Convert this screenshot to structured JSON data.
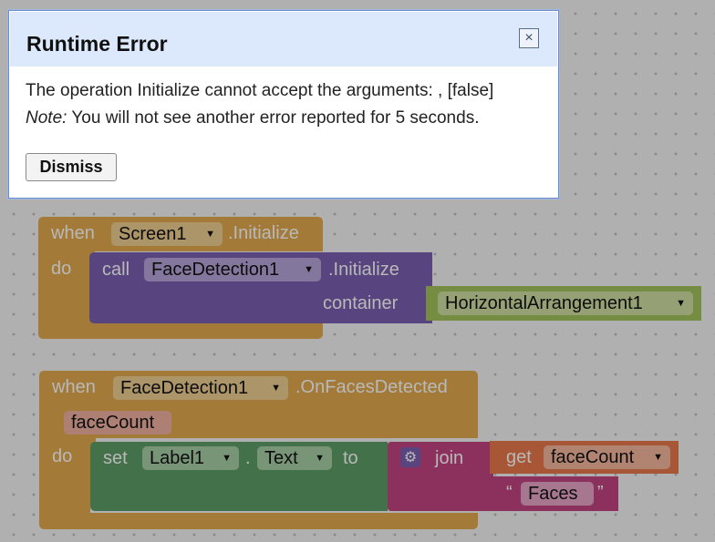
{
  "dialog": {
    "title": "Runtime Error",
    "close_glyph": "×",
    "message": "The operation Initialize cannot accept the arguments: , [false]",
    "note_label": "Note:",
    "note_text": "You will not see another error reported for 5 seconds.",
    "dismiss_label": "Dismiss"
  },
  "event1": {
    "when": "when",
    "component": "Screen1",
    "event": ".Initialize",
    "do": "do",
    "call": "call",
    "call_component": "FaceDetection1",
    "call_method": ".Initialize",
    "param": "container",
    "param_value": "HorizontalArrangement1"
  },
  "event2": {
    "when": "when",
    "component": "FaceDetection1",
    "event": ".OnFacesDetected",
    "param": "faceCount",
    "do": "do",
    "set": "set",
    "set_component": "Label1",
    "dot": ".",
    "property": "Text",
    "to": "to",
    "join": "join",
    "get": "get",
    "get_var": "faceCount",
    "quote_open": "“",
    "string_value": "Faces",
    "quote_close": "”"
  },
  "colors": {
    "event": "#e3a94f",
    "call": "#7a5fb0",
    "component": "#a2c35d",
    "set": "#5e9e67",
    "join": "#c24382",
    "get": "#e8794a",
    "string": "#c24382"
  }
}
